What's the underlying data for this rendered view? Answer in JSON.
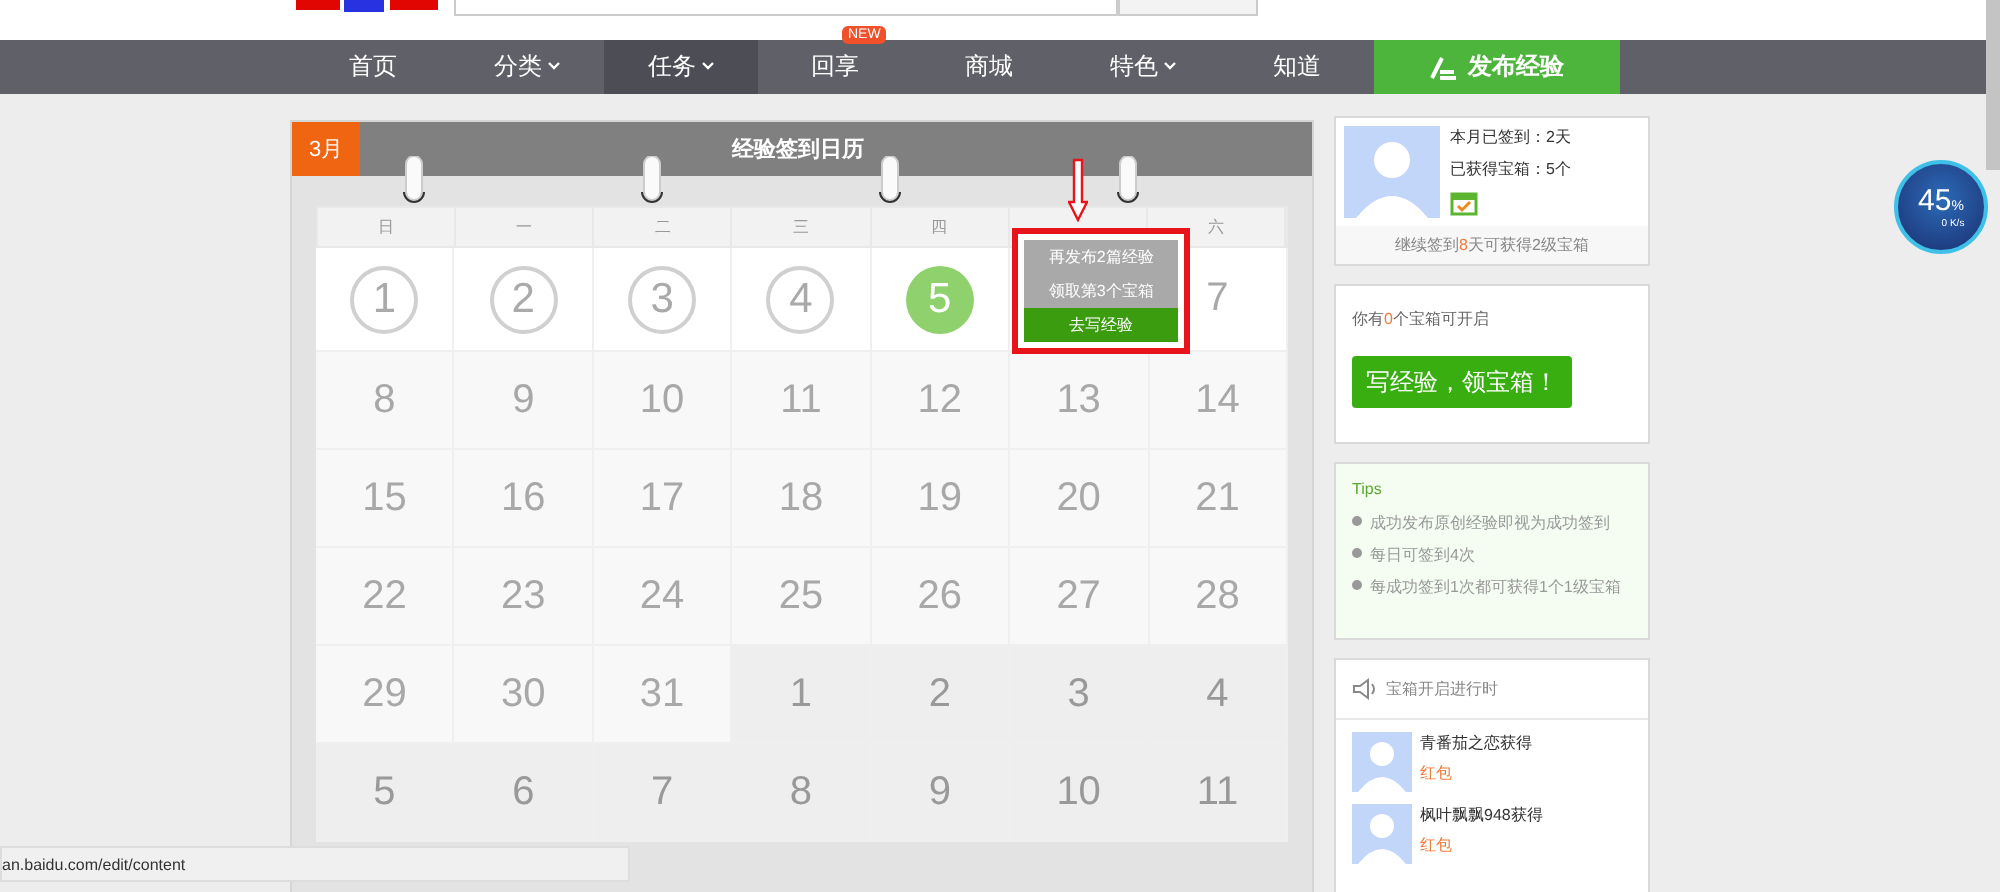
{
  "nav": {
    "items": [
      {
        "label": "首页",
        "selected": false,
        "dropdown": false
      },
      {
        "label": "分类",
        "selected": false,
        "dropdown": true
      },
      {
        "label": "任务",
        "selected": true,
        "dropdown": true
      },
      {
        "label": "回享",
        "selected": false,
        "dropdown": false,
        "badge": "NEW"
      },
      {
        "label": "商城",
        "selected": false,
        "dropdown": false
      },
      {
        "label": "特色",
        "selected": false,
        "dropdown": true
      },
      {
        "label": "知道",
        "selected": false,
        "dropdown": false
      }
    ],
    "publish_button": "发布经验"
  },
  "calendar": {
    "month": "3月",
    "title": "经验签到日历",
    "weekdays": [
      "日",
      "一",
      "二",
      "三",
      "四",
      "六"
    ],
    "rows": [
      [
        {
          "day": "1",
          "kind": "signed"
        },
        {
          "day": "2",
          "kind": "signed"
        },
        {
          "day": "3",
          "kind": "signed"
        },
        {
          "day": "4",
          "kind": "signed"
        },
        {
          "day": "5",
          "kind": "today"
        },
        {
          "kind": "popup"
        },
        {
          "day": "7",
          "kind": "future"
        }
      ],
      [
        {
          "day": "8",
          "kind": "future"
        },
        {
          "day": "9",
          "kind": "future"
        },
        {
          "day": "10",
          "kind": "future"
        },
        {
          "day": "11",
          "kind": "future"
        },
        {
          "day": "12",
          "kind": "future"
        },
        {
          "day": "13",
          "kind": "future"
        },
        {
          "day": "14",
          "kind": "future"
        }
      ],
      [
        {
          "day": "15",
          "kind": "future"
        },
        {
          "day": "16",
          "kind": "future"
        },
        {
          "day": "17",
          "kind": "future"
        },
        {
          "day": "18",
          "kind": "future"
        },
        {
          "day": "19",
          "kind": "future"
        },
        {
          "day": "20",
          "kind": "future"
        },
        {
          "day": "21",
          "kind": "future"
        }
      ],
      [
        {
          "day": "22",
          "kind": "future"
        },
        {
          "day": "23",
          "kind": "future"
        },
        {
          "day": "24",
          "kind": "future"
        },
        {
          "day": "25",
          "kind": "future"
        },
        {
          "day": "26",
          "kind": "future"
        },
        {
          "day": "27",
          "kind": "future"
        },
        {
          "day": "28",
          "kind": "future"
        }
      ],
      [
        {
          "day": "29",
          "kind": "future"
        },
        {
          "day": "30",
          "kind": "future"
        },
        {
          "day": "31",
          "kind": "future"
        },
        {
          "day": "1",
          "kind": "next"
        },
        {
          "day": "2",
          "kind": "next"
        },
        {
          "day": "3",
          "kind": "next"
        },
        {
          "day": "4",
          "kind": "next"
        }
      ],
      [
        {
          "day": "5",
          "kind": "next"
        },
        {
          "day": "6",
          "kind": "next"
        },
        {
          "day": "7",
          "kind": "next"
        },
        {
          "day": "8",
          "kind": "next"
        },
        {
          "day": "9",
          "kind": "next"
        },
        {
          "day": "10",
          "kind": "next"
        },
        {
          "day": "11",
          "kind": "next"
        }
      ]
    ],
    "popup": {
      "lines": [
        "再发布2篇经验",
        "领取第3个宝箱"
      ],
      "button": "去写经验"
    }
  },
  "profile": {
    "signed": "本月已签到：2天",
    "boxes": "已获得宝箱：5个",
    "footer_before": "继续签到",
    "footer_days": "8",
    "footer_after": "天可获得2级宝箱"
  },
  "boxes_card": {
    "before": "你有",
    "count": "0",
    "after": "个宝箱可开启",
    "button": "写经验，领宝箱！"
  },
  "tips": {
    "title": "Tips",
    "items": [
      "成功发布原创经验即视为成功签到",
      "每日可签到4次",
      "每成功签到1次都可获得1个1级宝箱"
    ]
  },
  "feed": {
    "title": "宝箱开启进行时",
    "items": [
      {
        "user": "青番茄之恋获得",
        "prize": "红包"
      },
      {
        "user": "枫叶飘飘948获得",
        "prize": "红包"
      }
    ]
  },
  "speed_widget": {
    "percent": "45",
    "unit": "%",
    "rate": "0 K/s"
  },
  "status_url": "an.baidu.com/edit/content"
}
